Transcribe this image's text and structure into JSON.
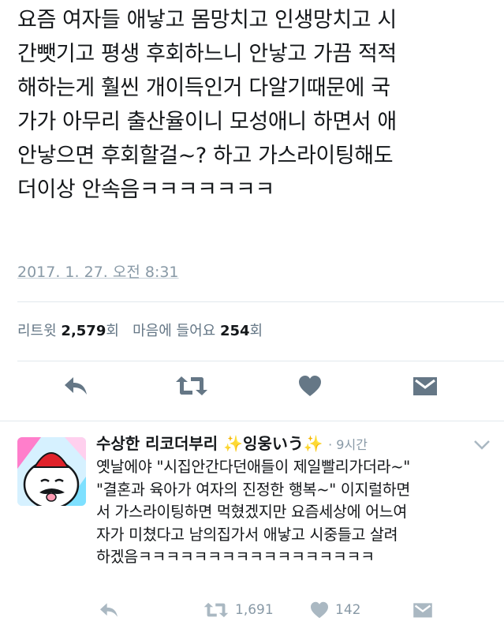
{
  "tweet": {
    "lines": [
      "요즘 여자들 애낳고 몸망치고 인생망치고 시",
      "간뺏기고 평생 후회하느니 안낳고 가끔 적적",
      "해하는게 훨씬 개이득인거 다알기때문에 국",
      "가가 아무리 출산율이니 모성애니 하면서 애",
      "안낳으면 후회할걸~? 하고 가스라이팅해도",
      "더이상 안속음ㅋㅋㅋㅋㅋㅋㅋ"
    ],
    "timestamp": "2017. 1. 27. 오전 8:31",
    "retweet_label": "리트윗",
    "retweet_count": "2,579",
    "retweet_unit": "회",
    "like_label": "마음에 들어요",
    "like_count": "254",
    "like_unit": "회"
  },
  "reply": {
    "name_part1": "수상한 리코더부리",
    "sparkle1": "✨",
    "name_part2": "잉웅いう",
    "sparkle2": "✨",
    "time": "· 9시간",
    "lines": [
      "옛날에야 \"시집안간다던애들이 제일빨리가더라~\"",
      "\"결혼과 육아가 여자의 진정한 행복~\" 이지럴하면",
      "서 가스라이팅하면 먹혔겠지만 요즘세상에 어느여",
      "자가 미쳤다고 남의집가서 애낳고 시중들고 살려",
      "하겠음ㅋㅋㅋㅋㅋㅋㅋㅋㅋㅋㅋㅋㅋㅋㅋㅋㅋ"
    ],
    "retweet_count": "1,691",
    "like_count": "142"
  },
  "colors": {
    "icon_gray": "#657786",
    "light_gray": "#aab8c2",
    "divider": "#e1e8ed"
  },
  "icons": [
    "reply-icon",
    "retweet-icon",
    "heart-icon",
    "dm-icon",
    "chevron-down-icon"
  ]
}
